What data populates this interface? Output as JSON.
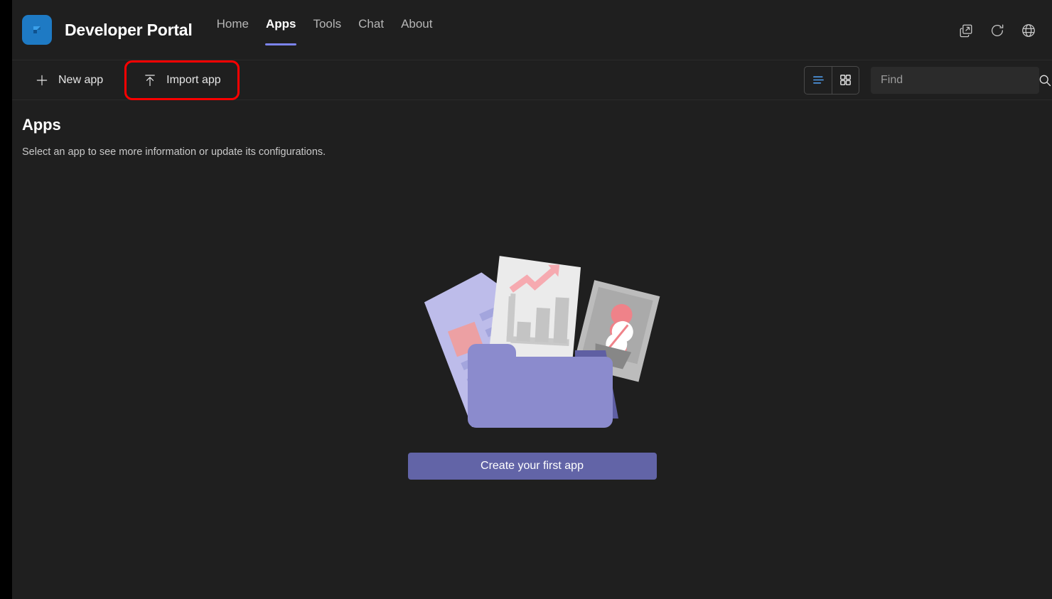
{
  "header": {
    "brand_title": "Developer Portal",
    "logo_icon": "teams-developer-portal-logo",
    "nav": [
      {
        "label": "Home",
        "active": false
      },
      {
        "label": "Apps",
        "active": true
      },
      {
        "label": "Tools",
        "active": false
      },
      {
        "label": "Chat",
        "active": false
      },
      {
        "label": "About",
        "active": false
      }
    ],
    "actions": [
      {
        "name": "open-in-new-window-icon",
        "label": "Open in new window"
      },
      {
        "name": "refresh-icon",
        "label": "Refresh"
      },
      {
        "name": "globe-icon",
        "label": "Language"
      }
    ],
    "active_tab_underline_color": "#7b83eb"
  },
  "toolbar": {
    "new_app_label": "New app",
    "new_app_icon": "plus-icon",
    "import_app_label": "Import app",
    "import_app_icon": "upload-arrow-icon",
    "highlight_color": "#fe0000",
    "view_toggle": {
      "list_view": {
        "name": "list-view-icon",
        "selected": true,
        "color": "#4f9bea"
      },
      "grid_view": {
        "name": "grid-view-icon",
        "selected": false,
        "color": "#e6e6e6"
      }
    },
    "search": {
      "placeholder": "Find",
      "value": "",
      "icon": "search-icon"
    }
  },
  "main": {
    "title": "Apps",
    "subtitle": "Select an app to see more information or update its configurations.",
    "empty_state": {
      "illustration": "folder-with-documents-illustration",
      "cta_label": "Create your first app",
      "cta_color": "#6264a7"
    }
  },
  "theme": {
    "background": "#1f1f1f",
    "window_border": "#000000",
    "text_primary": "#ffffff",
    "text_secondary": "#c9c9c9",
    "accent": "#6264a7",
    "logo_blue": "#1e7ac4"
  }
}
